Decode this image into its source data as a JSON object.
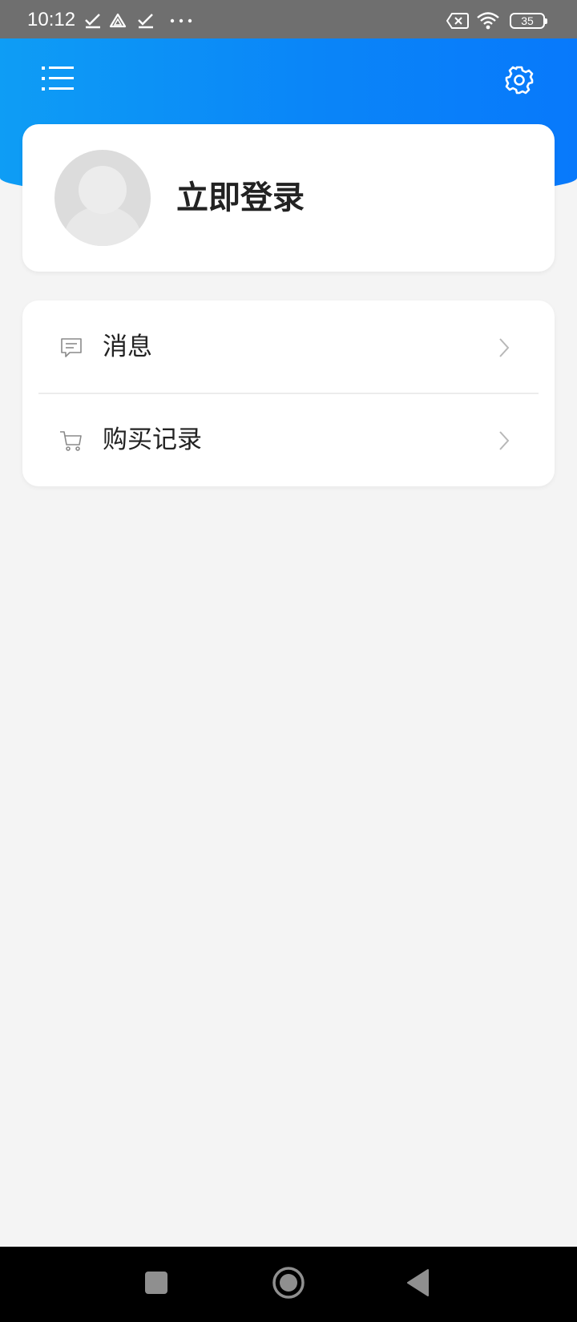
{
  "status_bar": {
    "time": "10:12",
    "battery_level": "35",
    "icons": [
      "check-icon",
      "drive-icon",
      "check-icon",
      "more-dots-icon",
      "sim-off-icon",
      "wifi-icon",
      "battery-icon"
    ]
  },
  "header": {
    "menu_icon": "list-menu-icon",
    "settings_icon": "gear-icon",
    "gradient_start": "#0e9df5",
    "gradient_end": "#0879fb"
  },
  "login_card": {
    "label": "立即登录",
    "avatar_icon": "default-avatar-icon"
  },
  "menu": {
    "items": [
      {
        "label": "消息",
        "icon": "message-icon"
      },
      {
        "label": "购买记录",
        "icon": "cart-icon"
      }
    ]
  },
  "nav_bar": {
    "buttons": [
      "recent-apps-button",
      "home-button",
      "back-button"
    ]
  },
  "colors": {
    "background": "#f4f4f4",
    "card": "#ffffff",
    "accent": "#0a85f8",
    "status_bar": "#6f6f6f",
    "nav_bar": "#000000"
  }
}
